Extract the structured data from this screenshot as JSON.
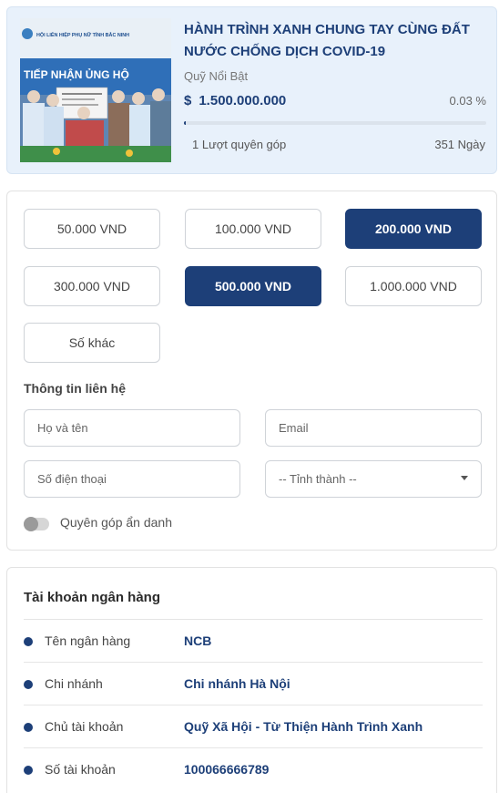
{
  "campaign": {
    "title": "HÀNH TRÌNH XANH CHUNG TAY CÙNG ĐẤT NƯỚC CHỐNG DỊCH COVID-19",
    "category": "Quỹ Nổi Bật",
    "currency_symbol": "$",
    "amount": "1.500.000.000",
    "percent": "0.03 %",
    "progress_fraction": 0.0003,
    "donations": "1 Lượt quyên góp",
    "days": "351 Ngày",
    "image": {
      "banner_text": "HỘI LIÊN HIỆP PHỤ NỮ TỈNH BẮC NINH",
      "sign_text": "TIẾP NHẬN ỦNG HỘ"
    }
  },
  "donate": {
    "amounts": [
      {
        "label": "50.000 VND",
        "selected": false
      },
      {
        "label": "100.000 VND",
        "selected": false
      },
      {
        "label": "200.000 VND",
        "selected": true
      },
      {
        "label": "300.000 VND",
        "selected": false
      },
      {
        "label": "500.000 VND",
        "selected": true
      },
      {
        "label": "1.000.000 VND",
        "selected": false
      }
    ],
    "other_label": "Số khác",
    "contact_heading": "Thông tin liên hệ",
    "name_placeholder": "Họ và tên",
    "email_placeholder": "Email",
    "phone_placeholder": "Số điện thoại",
    "province_select": "-- Tỉnh thành --",
    "anonymous_label": "Quyên góp ẩn danh",
    "anonymous_on": false
  },
  "bank": {
    "heading": "Tài khoản ngân hàng",
    "rows": [
      {
        "key": "Tên ngân hàng",
        "value": "NCB"
      },
      {
        "key": "Chi nhánh",
        "value": "Chi nhánh Hà Nội"
      },
      {
        "key": "Chủ tài khoản",
        "value": "Quỹ Xã Hội - Từ Thiện Hành Trình Xanh"
      },
      {
        "key": "Số tài khoản",
        "value": "100066666789"
      }
    ]
  },
  "colors": {
    "primary": "#1d3f78",
    "card_bg": "#e8f1fb"
  }
}
